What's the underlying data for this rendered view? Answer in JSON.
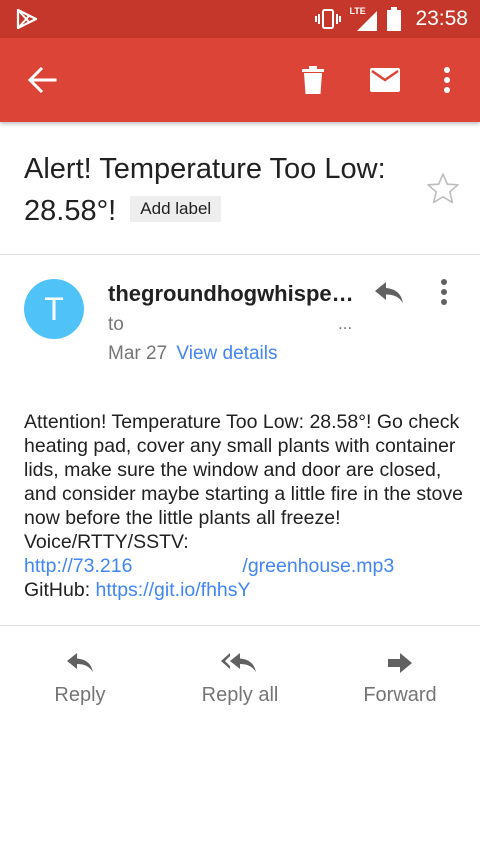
{
  "status_bar": {
    "network": "LTE",
    "time": "23:58"
  },
  "subject": {
    "title": "Alert! Temperature Too Low: 28.58°!",
    "label_button": "Add label"
  },
  "message": {
    "avatar_letter": "T",
    "sender": "thegroundhogwhisperer",
    "to_label": "to",
    "to_more": "...",
    "date": "Mar 27",
    "view_details": "View details",
    "body_text": "Attention! Temperature Too Low: 28.58°! Go check heating pad, cover any small plants with container lids, make sure the window and door are closed, and consider maybe starting a little fire in the stove now before the little plants all freeze! Voice/RTTY/SSTV:",
    "link1_start": "http://73.216",
    "link1_end": "/greenhouse.mp3",
    "github_label": "GitHub:",
    "github_link": "https://git.io/fhhsY"
  },
  "actions": {
    "reply": "Reply",
    "reply_all": "Reply all",
    "forward": "Forward"
  },
  "colors": {
    "status_bar": "#c5372b",
    "toolbar": "#db4437",
    "avatar": "#4fc3f7",
    "link": "#4285f4"
  }
}
